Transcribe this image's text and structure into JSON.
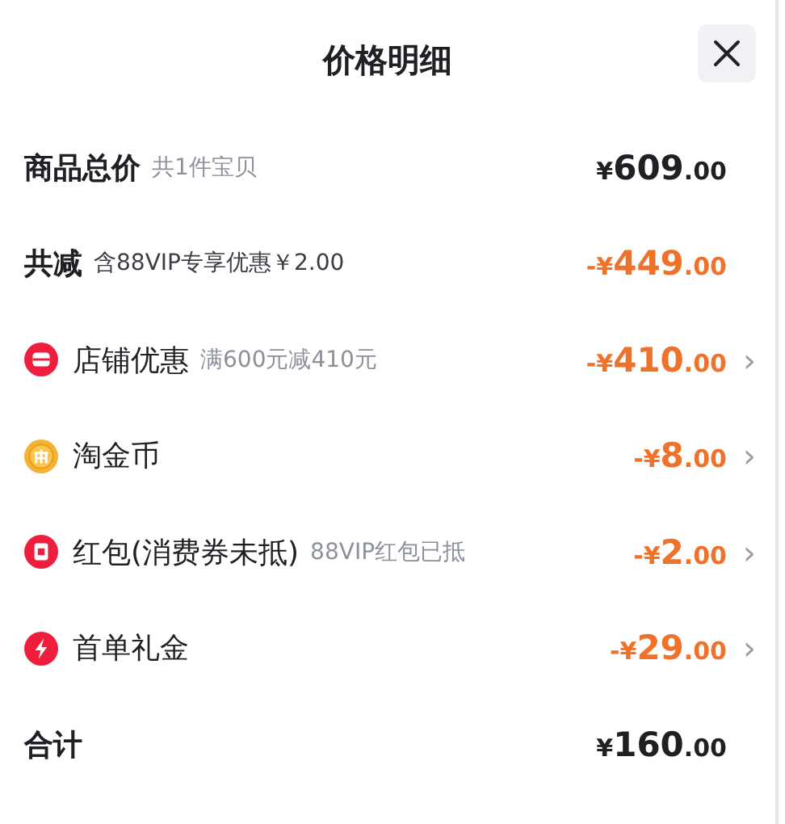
{
  "title": "价格明细",
  "rows": [
    {
      "kind": "summary",
      "label": "商品总价",
      "note": "共1件宝贝",
      "price": {
        "currency": "¥",
        "amount": "609",
        "fraction": ".00"
      }
    },
    {
      "kind": "saving",
      "label": "共减",
      "note": "含88VIP专享优惠￥2.00",
      "price": {
        "currency": "-¥",
        "amount": "449",
        "fraction": ".00"
      }
    },
    {
      "kind": "shop",
      "label": "店铺优惠",
      "note": "满600元减410元",
      "price": {
        "currency": "-¥",
        "amount": "410",
        "fraction": ".00"
      },
      "arrow": "›"
    },
    {
      "kind": "coin",
      "label": "淘金币",
      "price": {
        "currency": "-¥",
        "amount": "8",
        "fraction": ".00"
      },
      "arrow": "›"
    },
    {
      "kind": "packet",
      "label": "红包(消费券未抵)",
      "note": "88VIP红包已抵",
      "price": {
        "currency": "-¥",
        "amount": "2",
        "fraction": ".00"
      },
      "arrow": "›"
    },
    {
      "kind": "bolt",
      "label": "首单礼金",
      "price": {
        "currency": "-¥",
        "amount": "29",
        "fraction": ".00"
      },
      "arrow": "›"
    },
    {
      "kind": "summary",
      "label": "合计",
      "price": {
        "currency": "¥",
        "amount": "160",
        "fraction": ".00"
      }
    }
  ]
}
